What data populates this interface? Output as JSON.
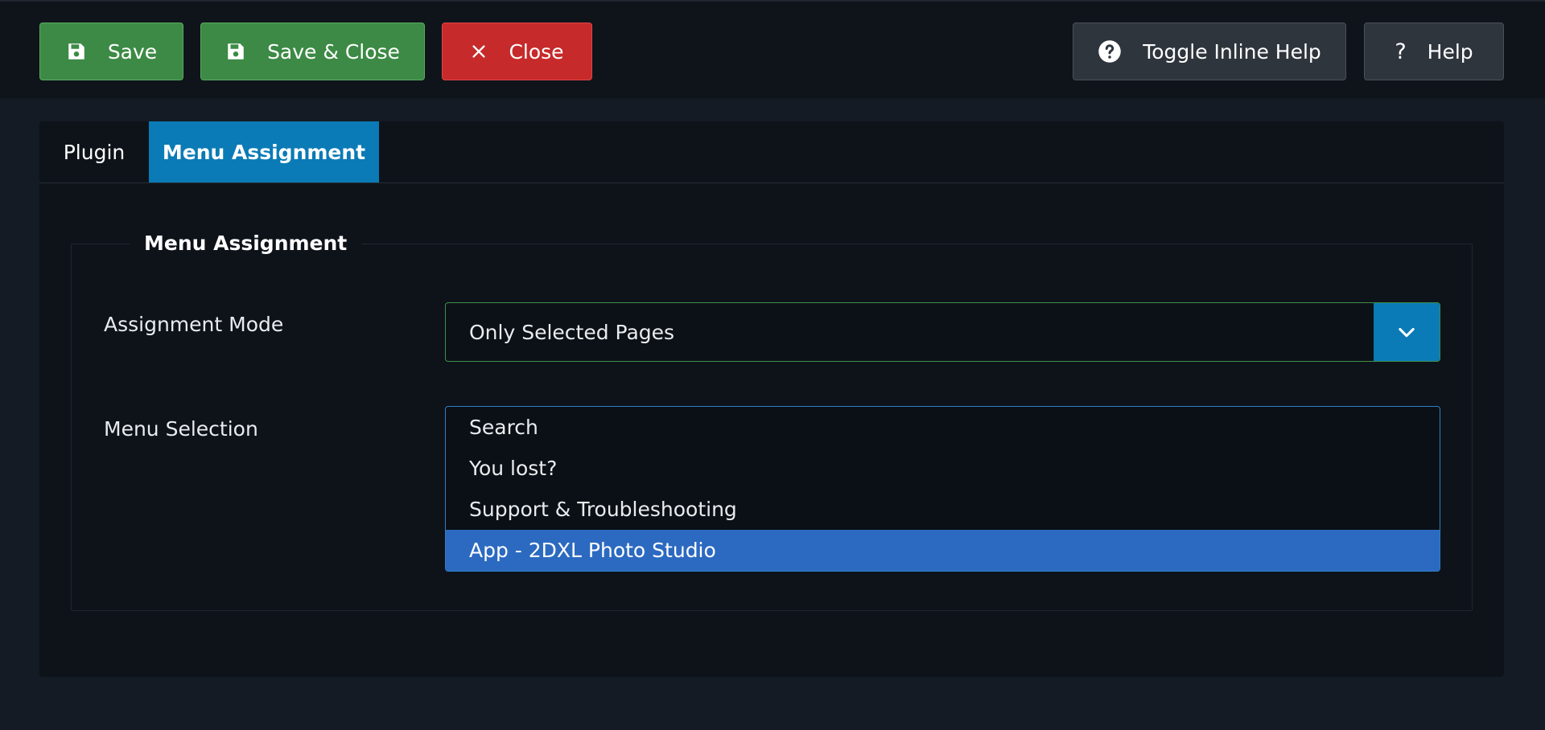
{
  "toolbar": {
    "save_label": "Save",
    "save_close_label": "Save & Close",
    "close_label": "Close",
    "toggle_help_label": "Toggle Inline Help",
    "help_label": "Help",
    "help_glyph": "?"
  },
  "tabs": [
    {
      "label": "Plugin",
      "active": false
    },
    {
      "label": "Menu Assignment",
      "active": true
    }
  ],
  "fieldset": {
    "legend": "Menu Assignment",
    "assignment_mode_label": "Assignment Mode",
    "assignment_mode_value": "Only Selected Pages",
    "menu_selection_label": "Menu Selection",
    "menu_options": [
      {
        "label": "Search",
        "selected": false
      },
      {
        "label": "You lost?",
        "selected": false
      },
      {
        "label": "Support & Troubleshooting",
        "selected": false
      },
      {
        "label": "App - 2DXL Photo Studio",
        "selected": true
      }
    ]
  },
  "colors": {
    "save_green": "#3c8a45",
    "close_red": "#c62a2a",
    "accent_blue": "#0a7bb6",
    "selected_option": "#2c6ac1"
  },
  "icons": {
    "save": "floppy-disk-icon",
    "close": "x-icon",
    "toggle_help": "question-circle-icon",
    "help": "question-mark-icon",
    "dropdown": "chevron-down-icon"
  }
}
